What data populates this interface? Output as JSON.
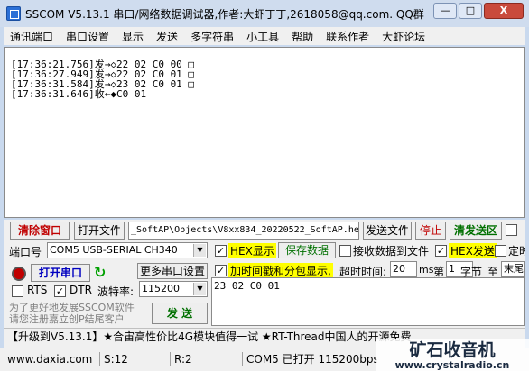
{
  "window": {
    "title": "SSCOM V5.13.1 串口/网络数据调试器,作者:大虾丁丁,2618058@qq.com. QQ群",
    "minimize": "—",
    "maximize": "□",
    "close": "X"
  },
  "menu": [
    "通讯端口",
    "串口设置",
    "显示",
    "发送",
    "多字符串",
    "小工具",
    "帮助",
    "联系作者",
    "大虾论坛"
  ],
  "receive_lines": [
    "[17:36:21.756]发→◇22 02 C0 00 □",
    "[17:36:27.949]发→◇22 02 C0 01 □",
    "[17:36:31.584]发→◇23 02 C0 01 □",
    "[17:36:31.646]收←◆C0 01"
  ],
  "toolbar": {
    "clear_window": "清除窗口",
    "open_file": "打开文件",
    "file_path": "_SoftAP\\Objects\\V8xx834_20220522_SoftAP.hex",
    "send_file": "发送文件",
    "stop": "停止",
    "clear_send": "清发送区"
  },
  "port": {
    "label": "端口号",
    "value": "COM5 USB-SERIAL CH340",
    "open_port": "打开串口",
    "more_settings": "更多串口设置",
    "rts": "RTS",
    "dtr": "DTR",
    "baud_label": "波特率:",
    "baud": "115200"
  },
  "options": {
    "hex_display": "HEX显示",
    "save_data": "保存数据",
    "recv_to_file": "接收数据到文件",
    "hex_send": "HEX发送",
    "timed_send": "定时",
    "timestamp": "加时间戳和分包显示,",
    "timeout_label": "超时时间:",
    "timeout": "20",
    "ms": "ms",
    "nth_label": "第",
    "nth": "1",
    "byte_label": "字节",
    "to_label": "至",
    "end_label": "末尾"
  },
  "send_text": "23 02 C0 01",
  "send_button": "发 送",
  "promo": "为了更好地发展SSCOM软件\n请您注册嘉立创P结尾客户",
  "ticker": "【升级到V5.13.1】★合宙高性价比4G模块值得一试 ★RT-Thread中国人的开源免费",
  "status": {
    "website": "www.daxia.com",
    "sent": "S:12",
    "received": "R:2",
    "port_state": "COM5 已打开  115200bps,8,1,None,None"
  },
  "watermark": {
    "cn": "矿石收音机",
    "url": "www.crystalradio.cn"
  },
  "colors": {
    "highlight_yellow": "#ffff00",
    "red_text": "#c00000",
    "green_text": "#007000",
    "blue_link": "#0000c0"
  }
}
